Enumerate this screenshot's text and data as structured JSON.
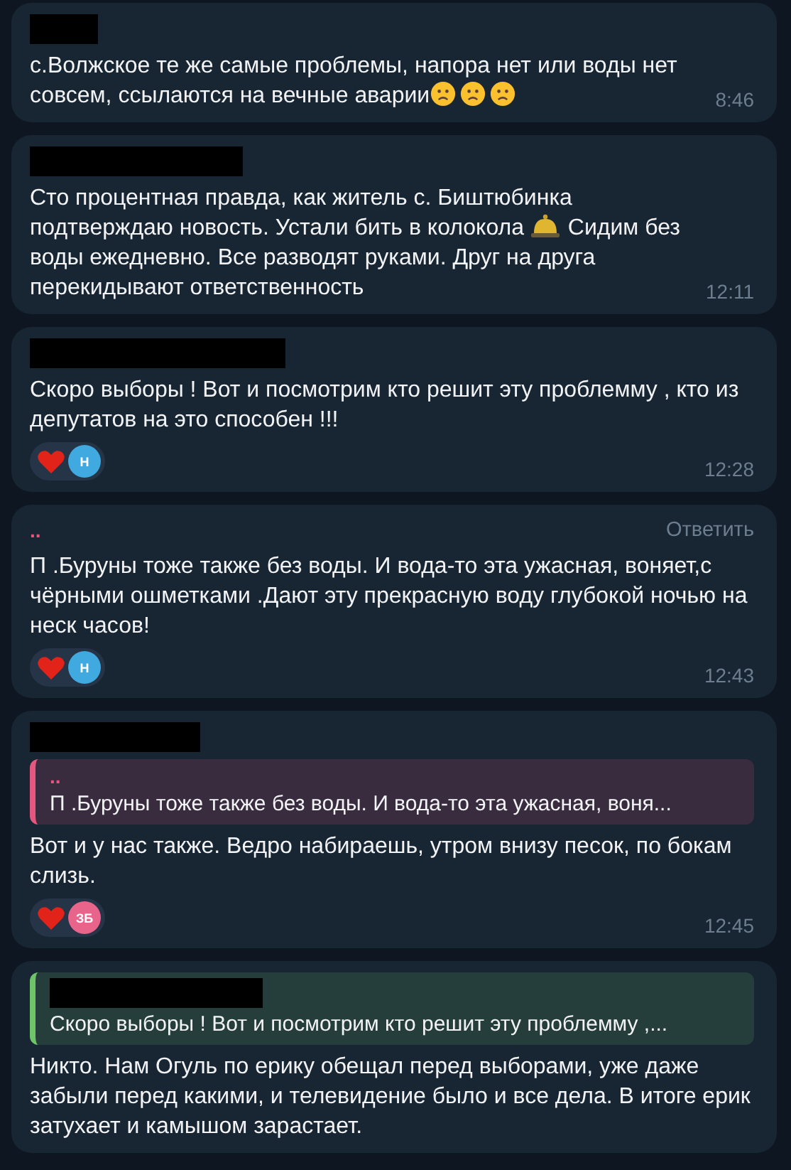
{
  "messages": [
    {
      "sender": {
        "redacted": true
      },
      "text": [
        {
          "kind": "text",
          "value": "с.Волжское те же самые проблемы, напора нет или воды нет совсем, ссылаются на вечные аварии"
        },
        {
          "kind": "frown"
        },
        {
          "kind": "frown"
        },
        {
          "kind": "frown"
        }
      ],
      "time": "8:46"
    },
    {
      "sender": {
        "redacted": true
      },
      "text": [
        {
          "kind": "text",
          "value": "Сто процентная правда, как житель с. Биштюбинка подтверждаю новость. Устали бить в колокола "
        },
        {
          "kind": "bell"
        },
        {
          "kind": "text",
          "value": " Сидим без воды ежедневно. Все разводят руками. Друг на друга перекидывают ответственность"
        }
      ],
      "time": "12:11"
    },
    {
      "sender": {
        "redacted": true
      },
      "text": [
        {
          "kind": "text",
          "value": "Скоро выборы ! Вот и посмотрим кто решит эту проблемму , кто из депутатов на это способен !!!"
        }
      ],
      "reactions": [
        {
          "initials": "Н",
          "color": "#3fa9e0"
        }
      ],
      "time": "12:28"
    },
    {
      "sender": {
        "redacted": false,
        "name": "..",
        "color": "#e5577f"
      },
      "reply_link": "Ответить",
      "text": [
        {
          "kind": "text",
          "value": "П .Буруны тоже также без воды.  И вода-то эта ужасная, воняет,с чёрными ошметками .Дают эту прекрасную воду глубокой ночью на неск часов!"
        }
      ],
      "reactions": [
        {
          "initials": "Н",
          "color": "#3fa9e0"
        }
      ],
      "time": "12:43"
    },
    {
      "sender": {
        "redacted": true
      },
      "quote": {
        "sender": {
          "redacted": false,
          "name": "..",
          "color": "#e5577f"
        },
        "text": "П .Буруны тоже также без воды.  И вода-то эта ужасная, воня..."
      },
      "text": [
        {
          "kind": "text",
          "value": "Вот и у нас также. Ведро набираешь, утром внизу песок, по бокам слизь."
        }
      ],
      "reactions": [
        {
          "initials": "ЗБ",
          "color": "#e8648a"
        }
      ],
      "time": "12:45"
    },
    {
      "quote": {
        "sender": {
          "redacted": true,
          "color": "#6fc46a"
        },
        "text": "Скоро выборы ! Вот и посмотрим кто решит эту проблемму ,..."
      },
      "text": [
        {
          "kind": "text",
          "value": "Никто. Нам Огуль по ерику обещал перед выборами, уже даже забыли перед какими, и телевидение было и все дела. В итоге ерик затухает и камышом зарастает."
        }
      ]
    }
  ]
}
